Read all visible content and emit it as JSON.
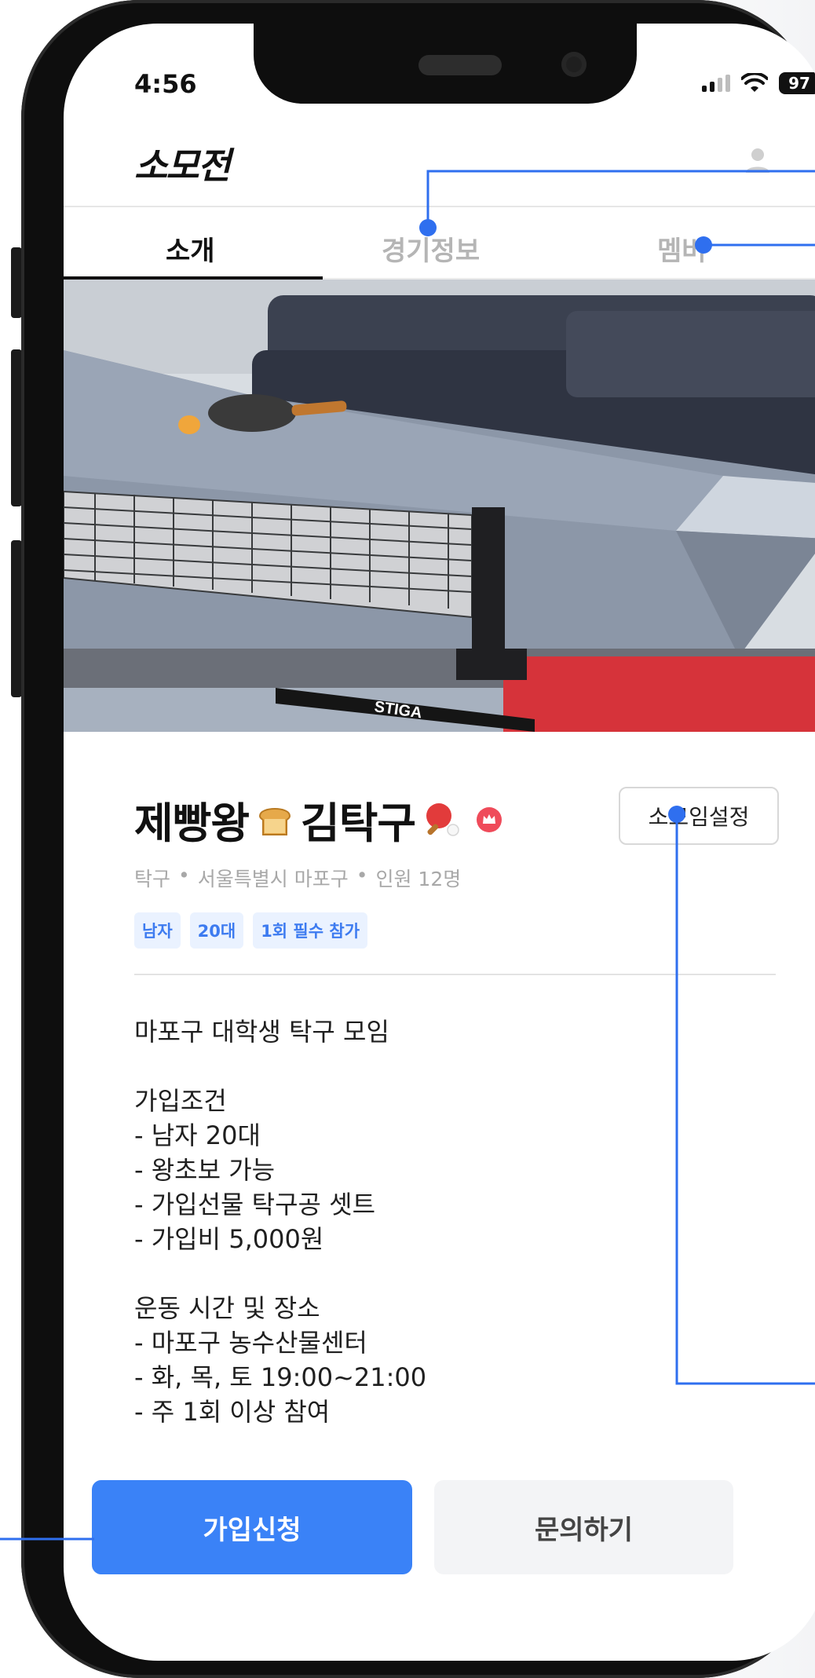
{
  "status_bar": {
    "time": "4:56",
    "battery": "97"
  },
  "app": {
    "logo": "소모전"
  },
  "tabs": [
    {
      "label": "소개",
      "active": true
    },
    {
      "label": "경기정보",
      "active": false
    },
    {
      "label": "멤버",
      "active": false
    }
  ],
  "club": {
    "name_part1": "제빵왕",
    "name_part2": "김탁구",
    "settings_button": "소모임설정",
    "meta": [
      "탁구",
      "•",
      "서울특별시 마포구",
      "•",
      "인원 12명"
    ],
    "tags": [
      "남자",
      "20대",
      "1회 필수 참가"
    ]
  },
  "description": {
    "intro": "마포구 대학생 탁구 모임",
    "conditions_title": "가입조건",
    "conditions": [
      "- 남자 20대",
      "- 왕초보 가능",
      "- 가입선물 탁구공 셋트",
      "- 가입비 5,000원"
    ],
    "schedule_title": "운동 시간 및 장소",
    "schedule": [
      "- 마포구 농수산물센터",
      "- 화, 목, 토 19:00~21:00",
      "- 주 1회 이상 참여"
    ]
  },
  "actions": {
    "join": "가입신청",
    "inquiry": "문의하기"
  },
  "colors": {
    "accent": "#3a82f7",
    "tag_bg": "#eaf2ff",
    "tag_text": "#3d7bf0",
    "annotation": "#2f6fef"
  },
  "icons": [
    "signal-icon",
    "wifi-icon",
    "battery-icon",
    "profile-icon",
    "bread-icon",
    "ping-pong-paddle-icon",
    "crown-badge-icon"
  ]
}
